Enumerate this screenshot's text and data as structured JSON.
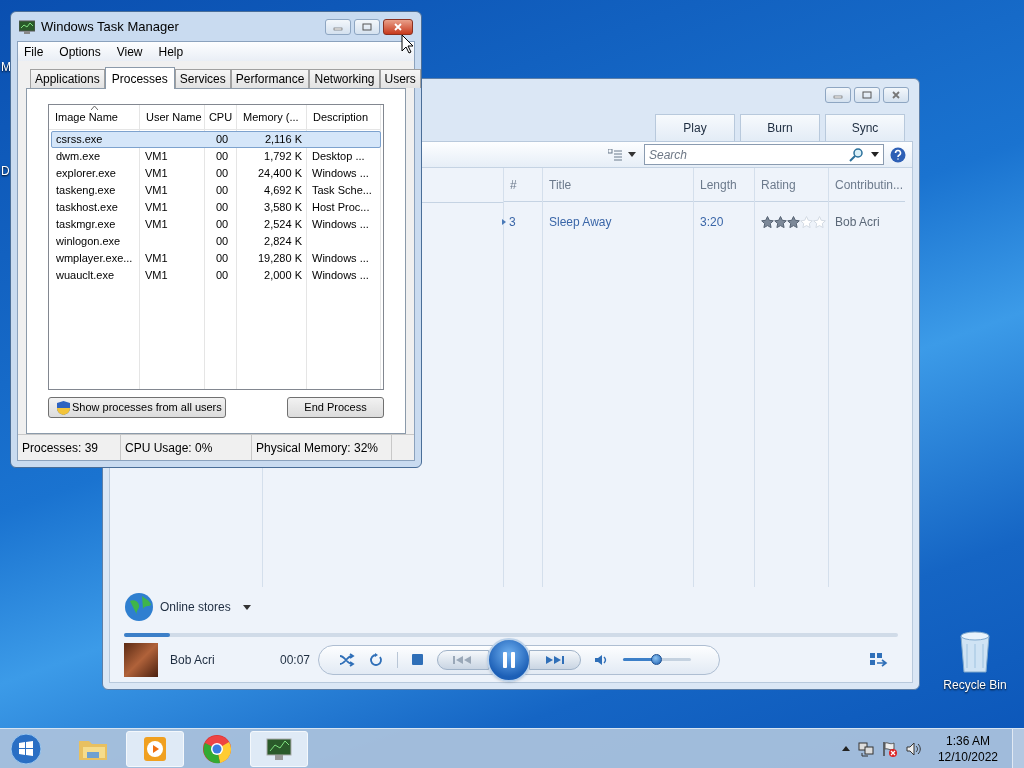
{
  "desktop": {
    "icons": [
      {
        "label": "M"
      },
      {
        "label": "D"
      }
    ],
    "recycle_bin": {
      "label": "Recycle Bin"
    }
  },
  "media_player": {
    "tabs": [
      "Play",
      "Burn",
      "Sync"
    ],
    "search": {
      "placeholder": "Search"
    },
    "columns": [
      "#",
      "Title",
      "Length",
      "Rating",
      "Contributin..."
    ],
    "rows": [
      {
        "number": "3",
        "title": "Sleep Away",
        "length": "3:20",
        "stars": 3,
        "artist": "Bob Acri",
        "playing": true
      }
    ],
    "online_stores": "Online stores",
    "now_playing": {
      "artist": "Bob Acri",
      "time": "00:07",
      "seek": {
        "level": 0.06
      },
      "volume": {
        "level": 0.48
      }
    }
  },
  "task_manager": {
    "title": "Windows Task Manager",
    "menu": [
      "File",
      "Options",
      "View",
      "Help"
    ],
    "tabs": [
      {
        "label": "Applications",
        "selected": false
      },
      {
        "label": "Processes",
        "selected": true
      },
      {
        "label": "Services",
        "selected": false
      },
      {
        "label": "Performance",
        "selected": false
      },
      {
        "label": "Networking",
        "selected": false
      },
      {
        "label": "Users",
        "selected": false
      }
    ],
    "columns": [
      "Image Name",
      "User Name",
      "CPU",
      "Memory (...",
      "Description"
    ],
    "rows": [
      {
        "image": "csrss.exe",
        "user": "",
        "cpu": "00",
        "memory": "2,116 K",
        "description": "",
        "selected": true
      },
      {
        "image": "dwm.exe",
        "user": "VM1",
        "cpu": "00",
        "memory": "1,792 K",
        "description": "Desktop ...",
        "selected": false
      },
      {
        "image": "explorer.exe",
        "user": "VM1",
        "cpu": "00",
        "memory": "24,400 K",
        "description": "Windows ...",
        "selected": false
      },
      {
        "image": "taskeng.exe",
        "user": "VM1",
        "cpu": "00",
        "memory": "4,692 K",
        "description": "Task Sche...",
        "selected": false
      },
      {
        "image": "taskhost.exe",
        "user": "VM1",
        "cpu": "00",
        "memory": "3,580 K",
        "description": "Host Proc...",
        "selected": false
      },
      {
        "image": "taskmgr.exe",
        "user": "VM1",
        "cpu": "00",
        "memory": "2,524 K",
        "description": "Windows ...",
        "selected": false
      },
      {
        "image": "winlogon.exe",
        "user": "",
        "cpu": "00",
        "memory": "2,824 K",
        "description": "",
        "selected": false
      },
      {
        "image": "wmplayer.exe...",
        "user": "VM1",
        "cpu": "00",
        "memory": "19,280 K",
        "description": "Windows ...",
        "selected": false
      },
      {
        "image": "wuauclt.exe",
        "user": "VM1",
        "cpu": "00",
        "memory": "2,000 K",
        "description": "Windows ...",
        "selected": false
      }
    ],
    "buttons": [
      {
        "label": "Show processes from all users",
        "kind": "shield"
      },
      {
        "label": "End Process",
        "kind": "plain"
      }
    ],
    "status_bar": [
      "Processes: 39",
      "CPU Usage: 0%",
      "Physical Memory: 32%"
    ]
  },
  "taskbar": {
    "items": [
      {
        "kind": "start"
      },
      {
        "kind": "folder",
        "running": false
      },
      {
        "kind": "media",
        "running": true
      },
      {
        "kind": "browser",
        "running": false
      },
      {
        "kind": "monitor",
        "running": true
      }
    ],
    "clock": {
      "time": "1:36 AM",
      "date": "12/10/2022"
    }
  }
}
